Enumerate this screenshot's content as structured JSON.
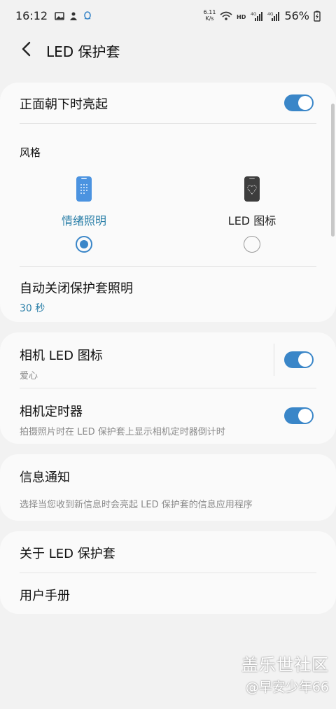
{
  "status_bar": {
    "time": "16:12",
    "net_speed_value": "6.11",
    "net_speed_unit": "K/s",
    "battery": "56%",
    "left_icons": [
      "gallery-icon",
      "game-icon",
      "qq-icon"
    ],
    "right_icons": [
      "wifi-icon",
      "hd-icon",
      "signal-4g-icon",
      "signal-4g-icon",
      "battery-charging-icon"
    ]
  },
  "app_bar": {
    "title": "LED 保护套"
  },
  "card1": {
    "face_down_label": "正面朝下时亮起",
    "face_down_enabled": true,
    "style_label": "风格",
    "options": [
      {
        "label": "情绪照明",
        "selected": true
      },
      {
        "label": "LED 图标",
        "selected": false
      }
    ],
    "auto_off_label": "自动关闭保护套照明",
    "auto_off_value": "30 秒"
  },
  "card2": {
    "camera_icon_label": "相机 LED 图标",
    "camera_icon_value": "爱心",
    "camera_icon_enabled": true,
    "timer_label": "相机定时器",
    "timer_desc": "拍摄照片时在 LED 保护套上显示相机定时器倒计时",
    "timer_enabled": true
  },
  "card3": {
    "notify_label": "信息通知",
    "notify_desc": "选择当您收到新信息时会亮起 LED 保护套的信息应用程序"
  },
  "card4": {
    "about_label": "关于 LED 保护套",
    "manual_label": "用户手册"
  },
  "watermark": {
    "line1": "盖乐世社区",
    "line2": "@早安少年66"
  },
  "colors": {
    "accent": "#3a86c8",
    "accent_text": "#2a7fa8",
    "background": "#f2f2f2",
    "card": "#fafafa"
  }
}
